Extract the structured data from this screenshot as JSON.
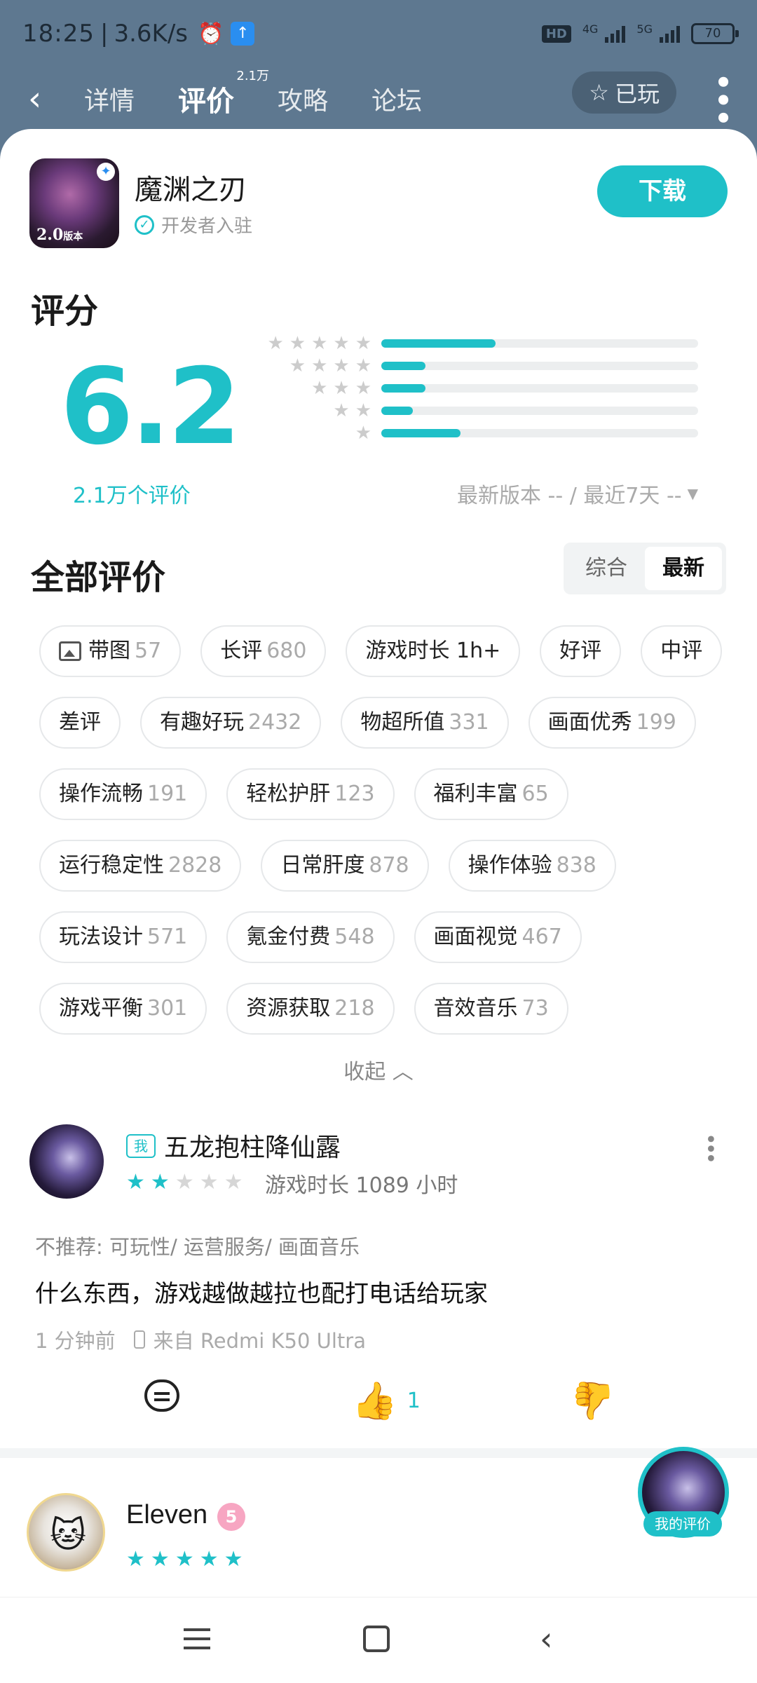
{
  "status_bar": {
    "time": "18:25",
    "speed": "3.6K/s",
    "alarm_icon": "alarm-clock-icon",
    "hd_label": "HD",
    "net1": "4G",
    "net2": "5G",
    "battery": "70"
  },
  "nav": {
    "tabs": [
      {
        "label": "详情"
      },
      {
        "label": "评价",
        "sup": "2.1万"
      },
      {
        "label": "攻略"
      },
      {
        "label": "论坛"
      }
    ],
    "played_label": "已玩"
  },
  "app": {
    "name": "魔渊之刃",
    "icon_version": "2.0",
    "icon_version_suffix": "版本",
    "developer_tag": "开发者入驻",
    "download_label": "下载"
  },
  "rating": {
    "title": "评分",
    "score": "6.2",
    "count_label": "2.1万个评价",
    "distribution": [
      {
        "stars": 5,
        "fraction": 0.36
      },
      {
        "stars": 4,
        "fraction": 0.14
      },
      {
        "stars": 3,
        "fraction": 0.14
      },
      {
        "stars": 2,
        "fraction": 0.1
      },
      {
        "stars": 1,
        "fraction": 0.25
      }
    ],
    "filter_label": "最新版本 -- / 最近7天 --"
  },
  "reviews_section": {
    "title": "全部评价",
    "sort_options": [
      "综合",
      "最新"
    ],
    "sort_selected": "最新",
    "tags": [
      [
        {
          "label": "带图",
          "count": "57",
          "icon": "image-icon"
        },
        {
          "label": "长评",
          "count": "680"
        },
        {
          "label": "游戏时长 1h+",
          "count": ""
        },
        {
          "label": "好评",
          "count": ""
        },
        {
          "label": "中评",
          "count": ""
        }
      ],
      [
        {
          "label": "差评",
          "count": ""
        },
        {
          "label": "有趣好玩",
          "count": "2432"
        },
        {
          "label": "物超所值",
          "count": "331"
        },
        {
          "label": "画面优秀",
          "count": "199"
        }
      ],
      [
        {
          "label": "操作流畅",
          "count": "191"
        },
        {
          "label": "轻松护肝",
          "count": "123"
        },
        {
          "label": "福利丰富",
          "count": "65"
        }
      ],
      [
        {
          "label": "运行稳定性",
          "count": "2828"
        },
        {
          "label": "日常肝度",
          "count": "878"
        },
        {
          "label": "操作体验",
          "count": "838"
        }
      ],
      [
        {
          "label": "玩法设计",
          "count": "571"
        },
        {
          "label": "氪金付费",
          "count": "548"
        },
        {
          "label": "画面视觉",
          "count": "467"
        }
      ],
      [
        {
          "label": "游戏平衡",
          "count": "301"
        },
        {
          "label": "资源获取",
          "count": "218"
        },
        {
          "label": "音效音乐",
          "count": "73"
        }
      ]
    ],
    "collapse_label": "收起"
  },
  "review1": {
    "me_tag": "我",
    "user": "五龙抱柱降仙露",
    "stars": 2,
    "playtime": "游戏时长 1089 小时",
    "not_recommend": "不推荐: 可玩性/ 运营服务/ 画面音乐",
    "text": "什么东西，游戏越做越拉也配打电话给玩家",
    "time": "1 分钟前",
    "device": "来自 Redmi K50 Ultra",
    "likes": "1"
  },
  "review2": {
    "user": "Eleven",
    "level": "5",
    "stars": 5
  },
  "fab": {
    "label": "我的评价"
  }
}
